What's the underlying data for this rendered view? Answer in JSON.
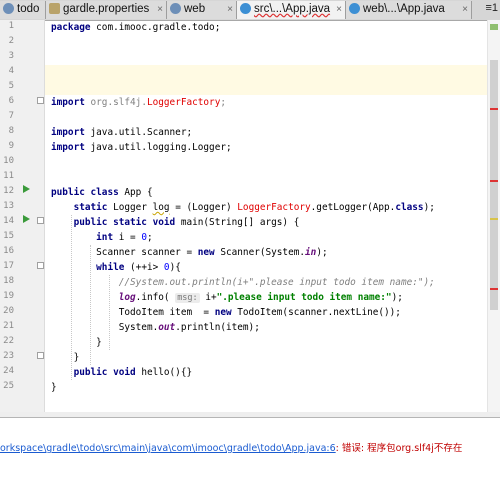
{
  "tabs": [
    {
      "label": "todo",
      "icon": "module-icon",
      "active": false
    },
    {
      "label": "gardle.properties",
      "icon": "properties-file-icon",
      "active": false
    },
    {
      "label": "web",
      "icon": "module-icon",
      "active": false
    },
    {
      "label": "src\\...\\App.java",
      "icon": "java-class-icon",
      "active": true
    },
    {
      "label": "web\\...\\App.java",
      "icon": "java-class-icon",
      "active": false
    }
  ],
  "tab_close_glyph": "×",
  "tab_overflow": "≡1",
  "line_numbers": [
    "1",
    "2",
    "3",
    "4",
    "5",
    "6",
    "7",
    "8",
    "9",
    "10",
    "11",
    "12",
    "13",
    "14",
    "15",
    "16",
    "17",
    "18",
    "19",
    "20",
    "21",
    "22",
    "23",
    "24",
    "25"
  ],
  "code": {
    "l1": {
      "kw": "package",
      "rest": " com.imooc.gradle.todo;"
    },
    "l6": {
      "kw": "import",
      "pkg": " org.slf4j.",
      "cls": "LoggerFactory",
      "end": ";"
    },
    "l8": {
      "kw": "import",
      "rest": " java.util.Scanner;"
    },
    "l9": {
      "kw": "import",
      "rest": " java.util.logging.Logger;"
    },
    "l12": {
      "kw": "public class",
      "rest": " App {"
    },
    "l13": {
      "kw": "static",
      "type": " Logger ",
      "var": "log",
      "mid": " = (Logger) ",
      "err": "LoggerFactory",
      "call": ".getLogger(App.",
      "kw2": "class",
      "end": ");"
    },
    "l14": {
      "kw": "public static void",
      "rest": " main(String[] args) {"
    },
    "l15": {
      "kw": "int",
      "rest": " i = ",
      "num": "0",
      "end": ";"
    },
    "l16": {
      "pre": "Scanner scanner = ",
      "kw": "new",
      "mid": " Scanner(System.",
      "fld": "in",
      "end": ");"
    },
    "l17": {
      "kw": "while",
      "pre": " (++i> ",
      "num": "0",
      "end": "){"
    },
    "l18": {
      "comment": "//System.out.println(i+\".please input todo item name:\");"
    },
    "l19": {
      "fld": "log",
      "pre": ".info( ",
      "hint": "msg:",
      "mid": " i+",
      "str": "\".please input todo item name:\"",
      "end": ");"
    },
    "l20": {
      "pre": "TodoItem item  = ",
      "kw": "new",
      "end": " TodoItem(scanner.nextLine());"
    },
    "l21": {
      "pre": "System.",
      "fld": "out",
      "end": ".println(item);"
    },
    "l22": {
      "rest": "}"
    },
    "l23": {
      "rest": "}"
    },
    "l24": {
      "kw": "public void",
      "rest": " hello(){}"
    },
    "l25": {
      "rest": "}"
    }
  },
  "message": {
    "path": "orkspace\\gradle\\todo\\src\\main\\java\\com\\imooc\\gradle\\todo\\App.java:6",
    "sep": ": ",
    "text": "错误: 程序包org.slf4j不存在"
  },
  "colors": {
    "keyword": "#000080",
    "error": "#e00000",
    "string": "#008000",
    "field": "#660e7a",
    "caret_line": "#fffae3",
    "run_marker": "#3a9a3a"
  }
}
